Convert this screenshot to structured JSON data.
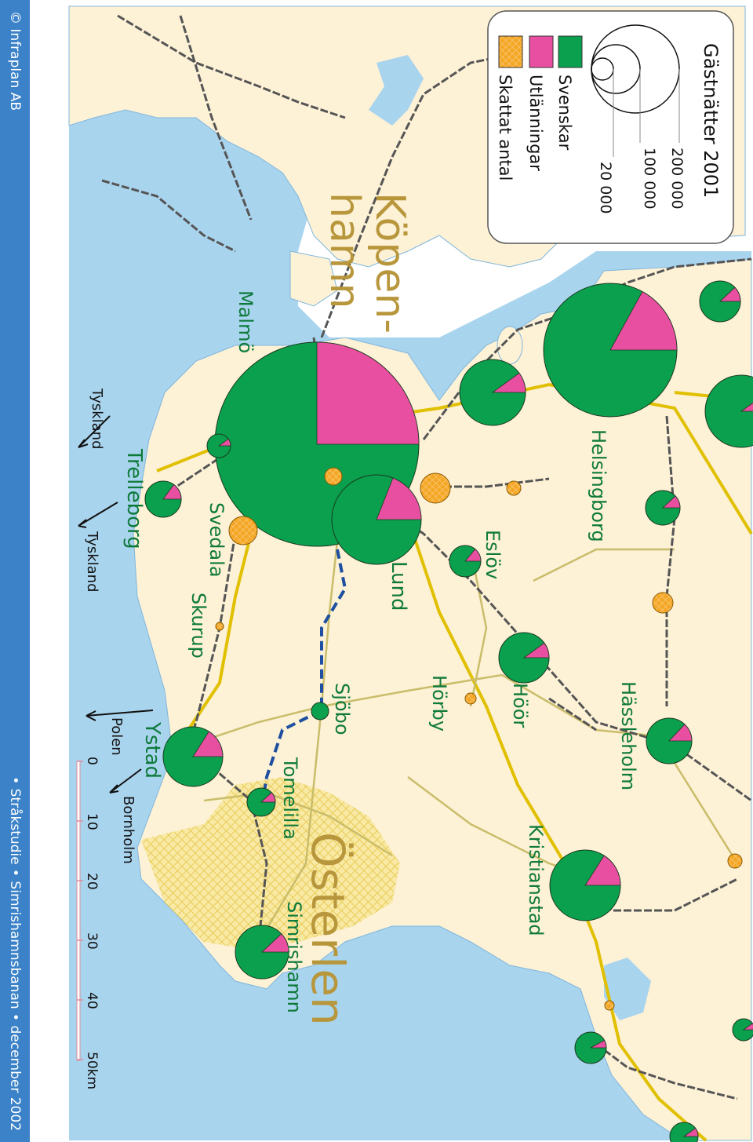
{
  "copyright": "© Infraplan AB",
  "footer": "• Stråkstudie • Simrishamnsbanan • december 2002",
  "legend": {
    "title": "Gästnätter 2001",
    "sizes": [
      "200 000",
      "100 000",
      "20 000"
    ],
    "items": [
      {
        "label": "Svenskar",
        "color": "#0aa04d"
      },
      {
        "label": "Utlänningar",
        "color": "#e84fa0"
      },
      {
        "label": "Skattat antal",
        "color": "#f5a623"
      }
    ]
  },
  "regions": {
    "kopenhamn": "Köpen-\nhamn",
    "osterlen": "Österlen"
  },
  "places": {
    "malmo": "Malmö",
    "helsingborg": "Helsingborg",
    "trelleborg": "Trelleborg",
    "svedala": "Svedala",
    "skurup": "Skurup",
    "lund": "Lund",
    "eslov": "Eslöv",
    "hoor": "Höör",
    "horby": "Hörby",
    "sjobo": "Sjöbo",
    "ystad": "Ystad",
    "tomelilla": "Tomelilla",
    "simrishamn": "Simrishamn",
    "hassleholm": "Hässleholm",
    "kristianstad": "Kristianstad"
  },
  "directions": {
    "tyskland1": "Tyskland",
    "tyskland2": "Tyskland",
    "polen": "Polen",
    "bornholm": "Bornholm"
  },
  "scale": {
    "ticks": [
      "0",
      "10",
      "20",
      "30",
      "40",
      "50km"
    ]
  },
  "colors": {
    "land": "#fdf1d6",
    "sea": "#a9d4ee",
    "swedes": "#0aa04d",
    "foreigners": "#e84fa0",
    "estimated": "#f5a623",
    "road": "#e0c000",
    "rail": "#666666"
  }
}
